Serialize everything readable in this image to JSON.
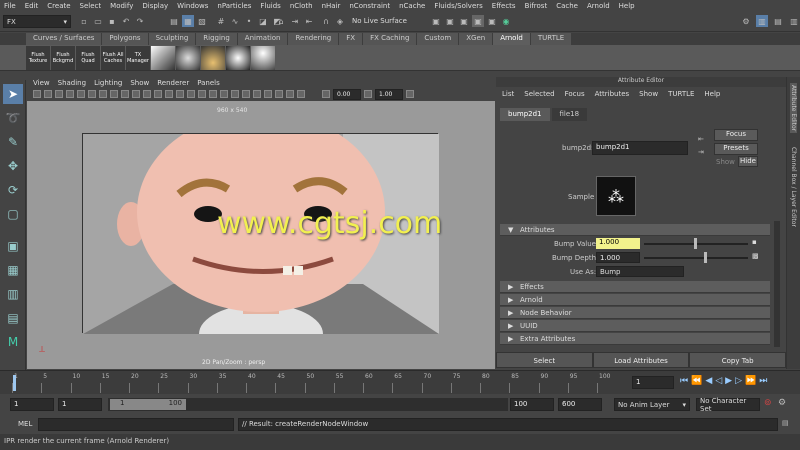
{
  "menubar": {
    "items": [
      "File",
      "Edit",
      "Create",
      "Select",
      "Modify",
      "Display",
      "Windows",
      "nParticles",
      "Fluids",
      "nCloth",
      "nHair",
      "nConstraint",
      "nCache",
      "Fluids/Solvers",
      "Effects",
      "Bifrost",
      "Cache",
      "Arnold",
      "Help"
    ]
  },
  "statusline": {
    "mode": "FX",
    "live_surface": "No Live Surface"
  },
  "shelf": {
    "tabs": [
      "Curves / Surfaces",
      "Polygons",
      "Sculpting",
      "Rigging",
      "Animation",
      "Rendering",
      "FX",
      "FX Caching",
      "Custom",
      "XGen",
      "Arnold",
      "TURTLE"
    ],
    "active_tab": "Arnold",
    "buttons": [
      "Flush Texture",
      "Flush Bckgrnd",
      "Flush Quad",
      "Flush All Caches",
      "TX Manager"
    ]
  },
  "viewport": {
    "menu": [
      "View",
      "Shading",
      "Lighting",
      "Show",
      "Renderer",
      "Panels"
    ],
    "resolution": "960 x 540",
    "camera_label": "2D Pan/Zoom : persp",
    "fields": [
      "0.00",
      "1.00"
    ],
    "watermark": "www.cgtsj.com"
  },
  "attribute_editor": {
    "title": "Attribute Editor",
    "menu": [
      "List",
      "Selected",
      "Focus",
      "Attributes",
      "Show",
      "TURTLE",
      "Help"
    ],
    "tabs": [
      "bump2d1",
      "file18"
    ],
    "node_label": "bump2d:",
    "node_value": "bump2d1",
    "focus_label": "Focus",
    "presets_label": "Presets",
    "show_label": "Show",
    "hide_label": "Hide",
    "sample_label": "Sample",
    "attributes_section": "Attributes",
    "bump_value_label": "Bump Value",
    "bump_value": "1.000",
    "bump_depth_label": "Bump Depth",
    "bump_depth": "1.000",
    "use_as_label": "Use As:",
    "use_as_value": "Bump",
    "sections": [
      "Effects",
      "Arnold",
      "Node Behavior",
      "UUID",
      "Extra Attributes"
    ],
    "bottom_buttons": [
      "Select",
      "Load Attributes",
      "Copy Tab"
    ]
  },
  "side_strip": {
    "labels": [
      "Attribute Editor",
      "Channel Box / Layer Editor"
    ]
  },
  "timeslider": {
    "ticks": [
      "1",
      "5",
      "10",
      "15",
      "20",
      "25",
      "30",
      "35",
      "40",
      "45",
      "50",
      "55",
      "60",
      "65",
      "70",
      "75",
      "80",
      "85",
      "90",
      "95",
      "100"
    ],
    "current_frame": "1"
  },
  "rangebar": {
    "start": "1",
    "start2": "1",
    "range_inner_start": "1",
    "range_inner_end": "100",
    "end": "100",
    "end2": "600",
    "anim_layer": "No Anim Layer",
    "char_set": "No Character Set"
  },
  "cmdline": {
    "label": "MEL",
    "result": "// Result: createRenderNodeWindow"
  },
  "helpline": {
    "text": "IPR render the current frame (Arnold Renderer)"
  }
}
